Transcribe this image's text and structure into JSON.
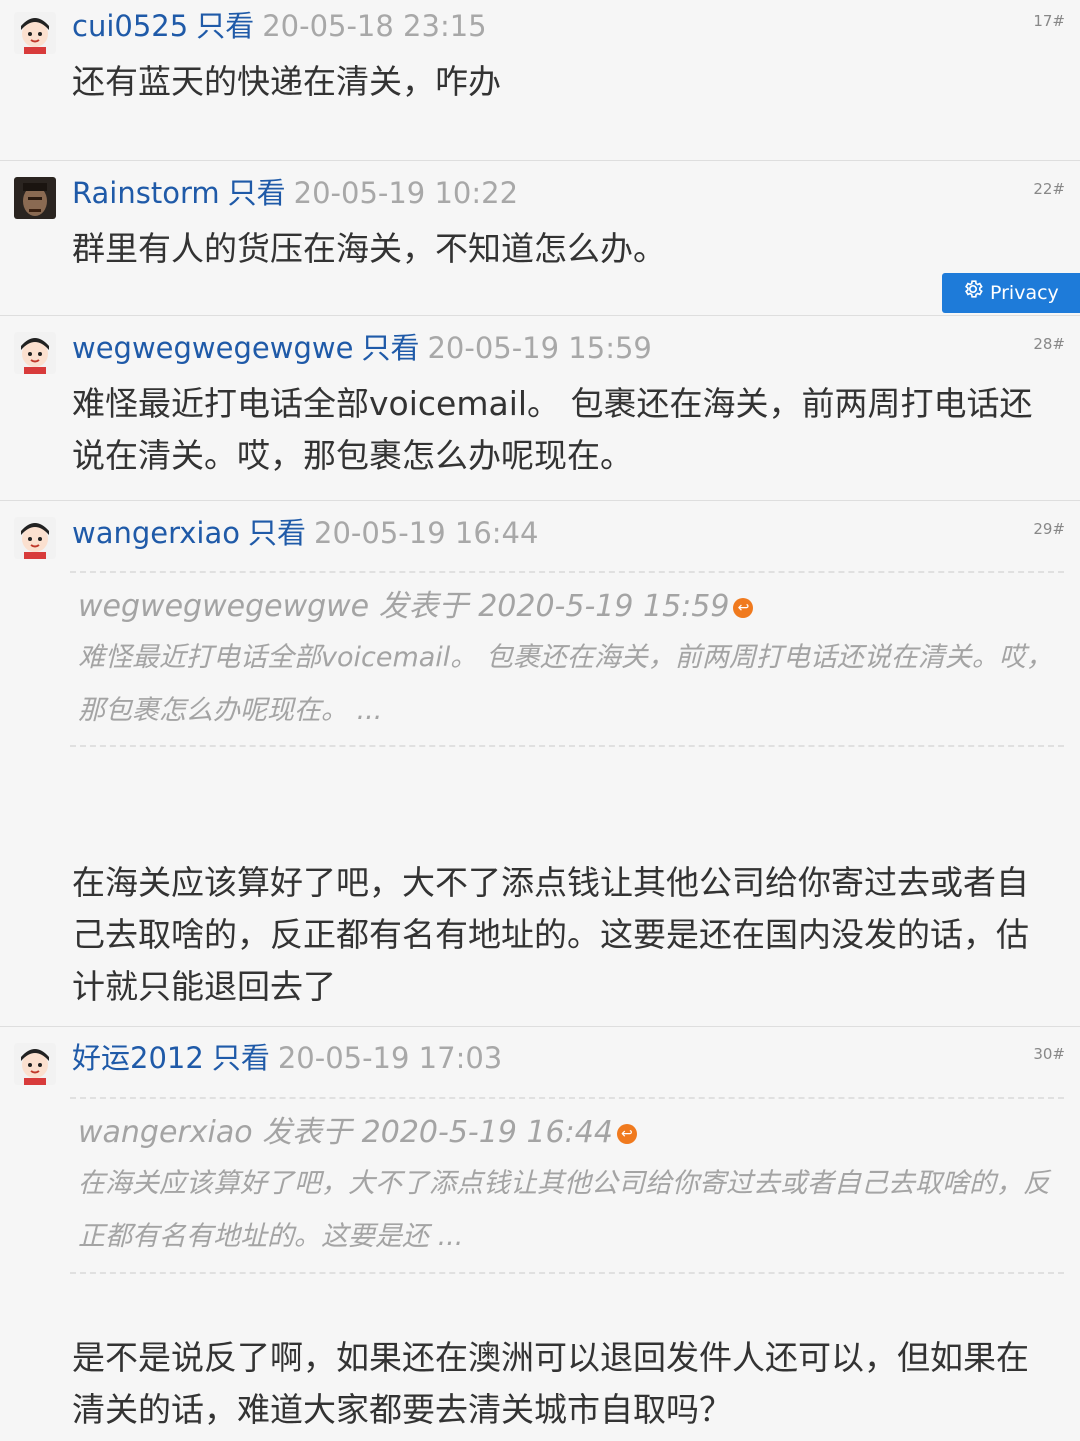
{
  "privacy_button": {
    "label": "Privacy",
    "icon": "gear-icon"
  },
  "posts": [
    {
      "username": "cui0525",
      "only_see": "只看",
      "time": "20-05-18 23:15",
      "floor": "17#",
      "content": "还有蓝天的快递在清关，咋办"
    },
    {
      "username": "Rainstorm",
      "only_see": "只看",
      "time": "20-05-19 10:22",
      "floor": "22#",
      "content": "群里有人的货压在海关，不知道怎么办。"
    },
    {
      "username": "wegwegwegewgwe",
      "only_see": "只看",
      "time": "20-05-19 15:59",
      "floor": "28#",
      "content": "难怪最近打电话全部voicemail。 包裹还在海关，前两周打电话还说在清关。哎，那包裹怎么办呢现在。"
    },
    {
      "username": "wangerxiao",
      "only_see": "只看",
      "time": "20-05-19 16:44",
      "floor": "29#",
      "quote": {
        "header": "wegwegwegewgwe 发表于 2020-5-19 15:59",
        "body": "难怪最近打电话全部voicemail。 包裹还在海关，前两周打电话还说在清关。哎，那包裹怎么办呢现在。 ..."
      },
      "content": "在海关应该算好了吧，大不了添点钱让其他公司给你寄过去或者自己去取啥的，反正都有名有地址的。这要是还在国内没发的话，估计就只能退回去了"
    },
    {
      "username": "好运2012",
      "only_see": "只看",
      "time": "20-05-19 17:03",
      "floor": "30#",
      "quote": {
        "header": "wangerxiao 发表于 2020-5-19 16:44",
        "body": "在海关应该算好了吧，大不了添点钱让其他公司给你寄过去或者自己去取啥的，反正都有名有地址的。这要是还 ..."
      },
      "content": "是不是说反了啊，如果还在澳洲可以退回发件人还可以，但如果在清关的话，难道大家都要去清关城市自取吗？"
    }
  ]
}
